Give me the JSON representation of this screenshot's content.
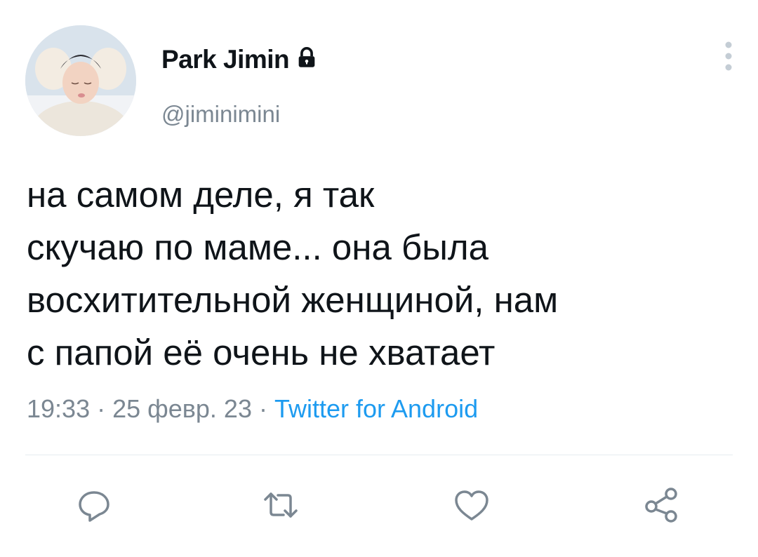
{
  "tweet": {
    "author": {
      "display_name": "Park Jimin",
      "handle": "@jiminimini",
      "protected_icon": "lock-icon"
    },
    "text": "на самом деле, я так\nскучаю по маме... она была\nвосхитительной женщиной, нам\nс папой её очень не хватает",
    "time": "19:33",
    "date": "25 февр. 23",
    "separator": " · ",
    "source": "Twitter for Android"
  },
  "actions": [
    {
      "icon": "reply-icon"
    },
    {
      "icon": "retweet-icon"
    },
    {
      "icon": "like-icon"
    },
    {
      "icon": "share-icon"
    }
  ],
  "colors": {
    "text": "#0f1419",
    "secondary": "#7b8792",
    "accent": "#1d9bf0",
    "divider": "#e6ecf0"
  }
}
